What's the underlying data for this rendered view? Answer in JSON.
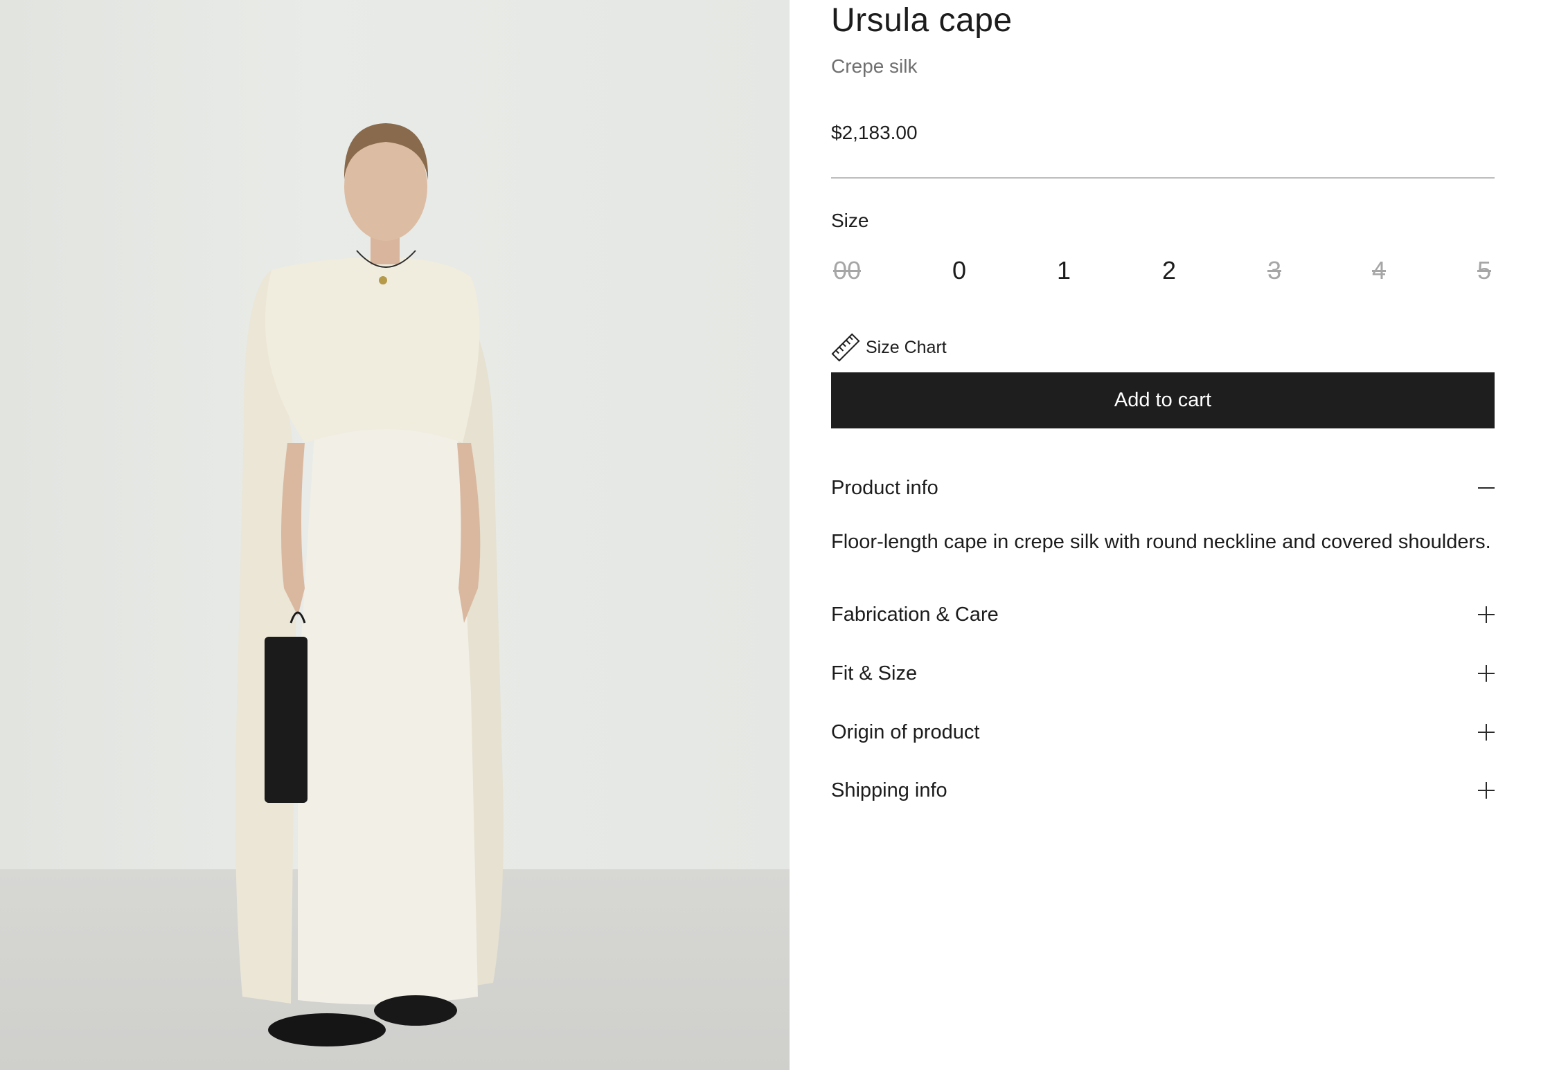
{
  "product": {
    "title": "Ursula cape",
    "subtitle": "Crepe silk",
    "price": "$2,183.00"
  },
  "size": {
    "label": "Size",
    "options": [
      {
        "label": "00",
        "available": false
      },
      {
        "label": "0",
        "available": true
      },
      {
        "label": "1",
        "available": true
      },
      {
        "label": "2",
        "available": true
      },
      {
        "label": "3",
        "available": false
      },
      {
        "label": "4",
        "available": false
      },
      {
        "label": "5",
        "available": false
      }
    ],
    "chart_label": "Size Chart",
    "chart_icon": "ruler-icon"
  },
  "cart": {
    "label": "Add to cart",
    "background": "#1e1e1e"
  },
  "accordion": {
    "product_info": {
      "label": "Product info",
      "expanded": true,
      "icon": "minus-icon",
      "content": "Floor-length cape in crepe silk with round neckline and covered shoulders."
    },
    "fabrication": {
      "label": "Fabrication & Care",
      "expanded": false,
      "icon": "plus-icon"
    },
    "fit": {
      "label": "Fit & Size",
      "expanded": false,
      "icon": "plus-icon"
    },
    "origin": {
      "label": "Origin of product",
      "expanded": false,
      "icon": "plus-icon"
    },
    "shipping": {
      "label": "Shipping info",
      "expanded": false,
      "icon": "plus-icon"
    }
  }
}
